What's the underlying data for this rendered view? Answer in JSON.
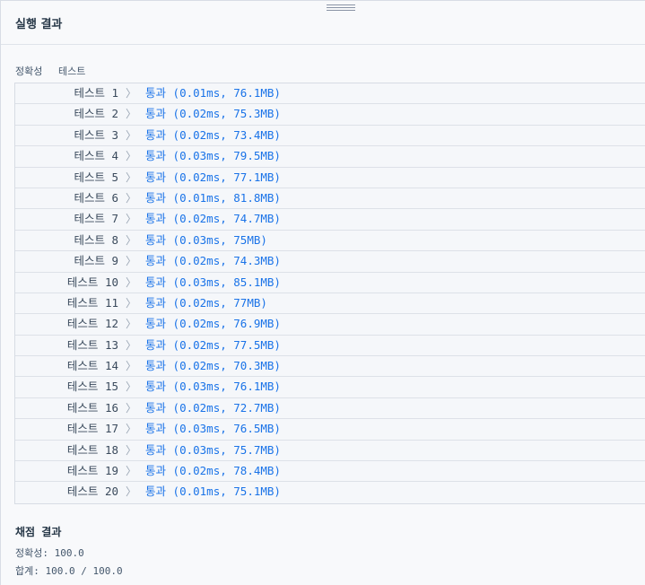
{
  "header": {
    "title": "실행 결과"
  },
  "tabs": {
    "accuracy": "정확성",
    "test": "테스트"
  },
  "tests": [
    {
      "name": "테스트 1",
      "status": "통과",
      "detail": "(0.01ms, 76.1MB)"
    },
    {
      "name": "테스트 2",
      "status": "통과",
      "detail": "(0.02ms, 75.3MB)"
    },
    {
      "name": "테스트 3",
      "status": "통과",
      "detail": "(0.02ms, 73.4MB)"
    },
    {
      "name": "테스트 4",
      "status": "통과",
      "detail": "(0.03ms, 79.5MB)"
    },
    {
      "name": "테스트 5",
      "status": "통과",
      "detail": "(0.02ms, 77.1MB)"
    },
    {
      "name": "테스트 6",
      "status": "통과",
      "detail": "(0.01ms, 81.8MB)"
    },
    {
      "name": "테스트 7",
      "status": "통과",
      "detail": "(0.02ms, 74.7MB)"
    },
    {
      "name": "테스트 8",
      "status": "통과",
      "detail": "(0.03ms, 75MB)"
    },
    {
      "name": "테스트 9",
      "status": "통과",
      "detail": "(0.02ms, 74.3MB)"
    },
    {
      "name": "테스트 10",
      "status": "통과",
      "detail": "(0.03ms, 85.1MB)"
    },
    {
      "name": "테스트 11",
      "status": "통과",
      "detail": "(0.02ms, 77MB)"
    },
    {
      "name": "테스트 12",
      "status": "통과",
      "detail": "(0.02ms, 76.9MB)"
    },
    {
      "name": "테스트 13",
      "status": "통과",
      "detail": "(0.02ms, 77.5MB)"
    },
    {
      "name": "테스트 14",
      "status": "통과",
      "detail": "(0.02ms, 70.3MB)"
    },
    {
      "name": "테스트 15",
      "status": "통과",
      "detail": "(0.03ms, 76.1MB)"
    },
    {
      "name": "테스트 16",
      "status": "통과",
      "detail": "(0.02ms, 72.7MB)"
    },
    {
      "name": "테스트 17",
      "status": "통과",
      "detail": "(0.03ms, 76.5MB)"
    },
    {
      "name": "테스트 18",
      "status": "통과",
      "detail": "(0.03ms, 75.7MB)"
    },
    {
      "name": "테스트 19",
      "status": "통과",
      "detail": "(0.02ms, 78.4MB)"
    },
    {
      "name": "테스트 20",
      "status": "통과",
      "detail": "(0.01ms, 75.1MB)"
    }
  ],
  "chevron_icon": "chevron-right-icon",
  "score": {
    "title": "채점 결과",
    "accuracy_label": "정확성",
    "accuracy_value": "100.0",
    "total_label": "합계",
    "total_value": "100.0 / 100.0"
  },
  "colors": {
    "pass": "#1a73e8",
    "text": "#3a4a5c",
    "background": "#f8f9fb"
  }
}
